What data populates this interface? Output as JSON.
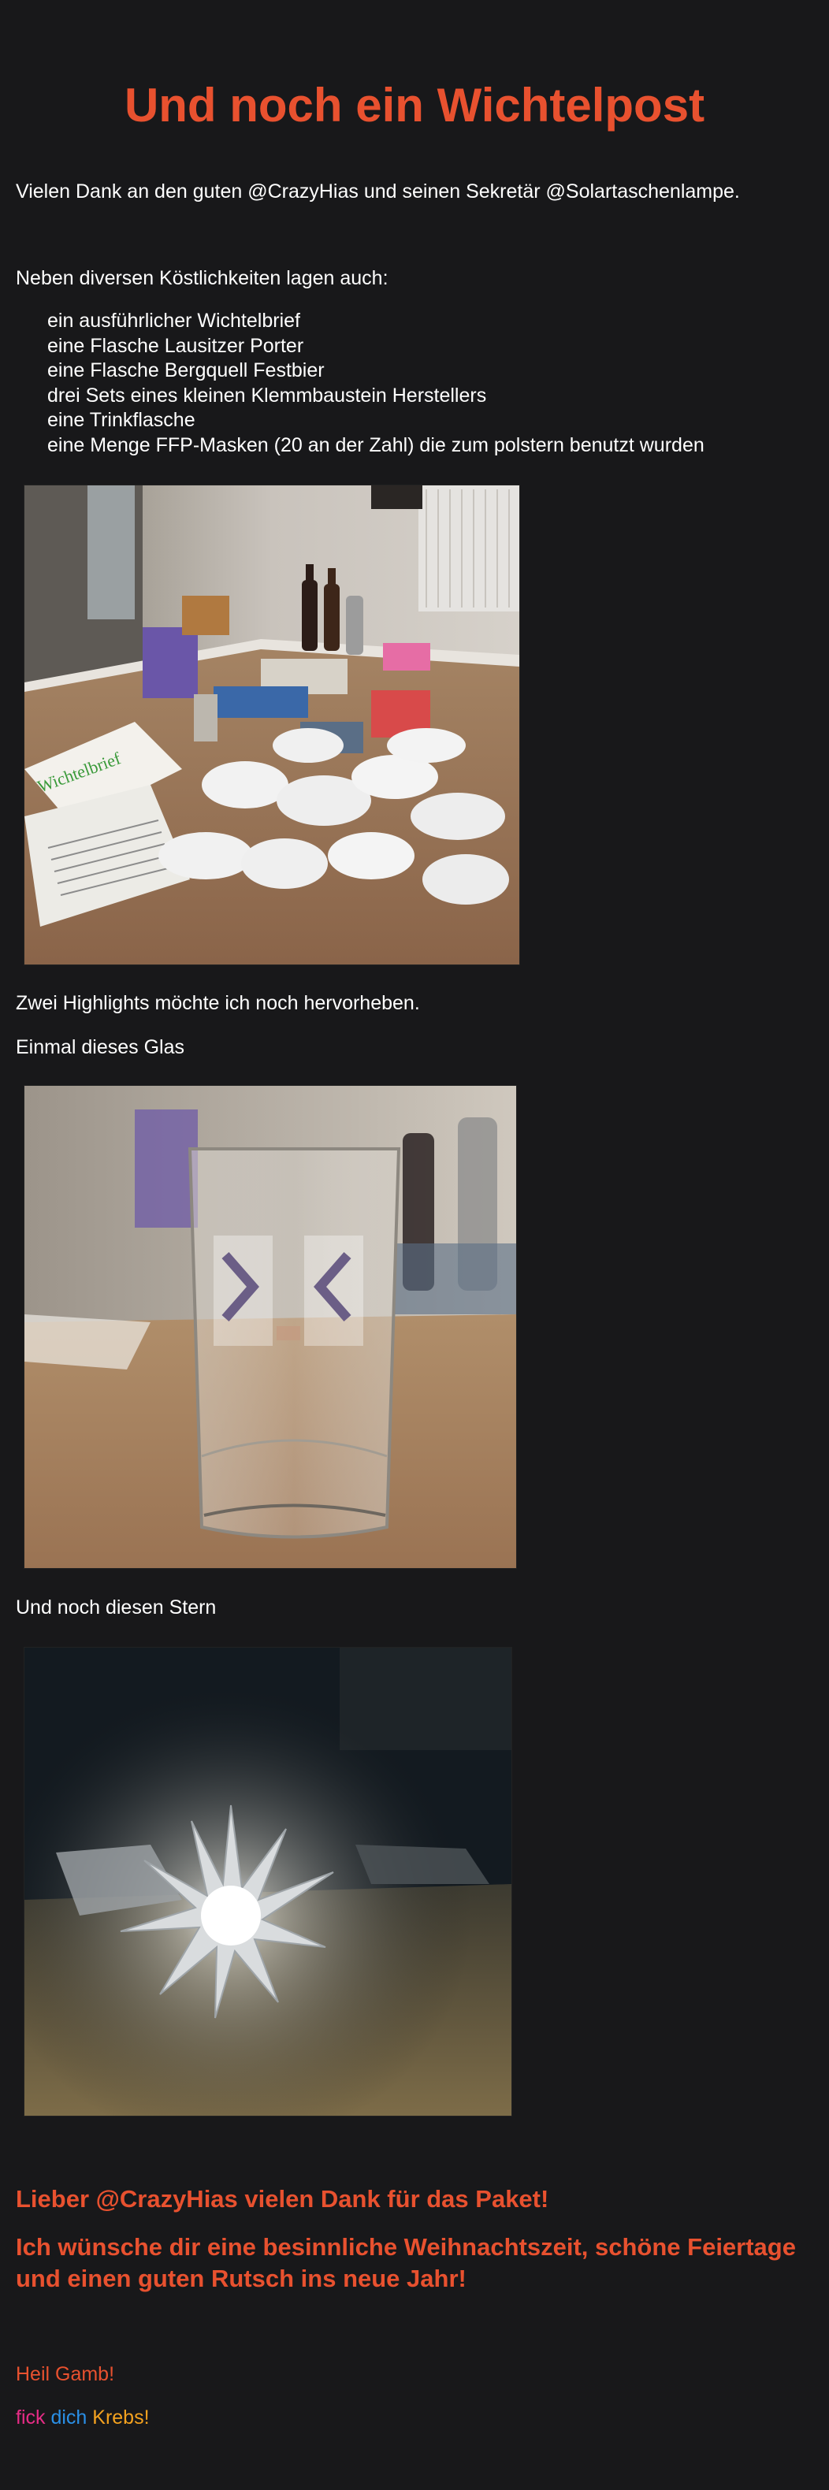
{
  "title": "Und noch ein Wichtelpost",
  "intro": "Vielen Dank an den guten @CrazyHias und seinen Sekretär @Solartaschenlampe.",
  "contents_intro": "Neben diversen Köstlichkeiten lagen auch:",
  "items": [
    "ein ausführlicher Wichtelbrief",
    "eine Flasche Lausitzer Porter",
    "eine Flasche Bergquell Festbier",
    "drei Sets eines kleinen Klemmbaustein Herstellers",
    "eine Trinkflasche",
    "eine Menge FFP-Masken (20 an der Zahl) die zum polstern benutzt wurden"
  ],
  "photo1": {
    "letter_text": "Wichtelbrief"
  },
  "highlights": "Zwei Highlights möchte ich noch hervorheben.",
  "glass_intro": "Einmal dieses Glas",
  "star_intro": "Und noch diesen Stern",
  "thanks": "Lieber @CrazyHias vielen Dank für das Paket!",
  "wishes": "Ich wünsche dir eine besinnliche Weihnachtszeit, schöne Feiertage und einen guten Rutsch ins neue Jahr!",
  "greeting": "Heil Gamb!",
  "signoff": [
    "fick",
    "dich",
    "Krebs!"
  ],
  "colors": {
    "background": "#18181a",
    "accent": "#e8512f",
    "text": "#ffffff",
    "signoff_1": "#e62c86",
    "signoff_2": "#2a8fe6",
    "signoff_3": "#f4a21f"
  }
}
